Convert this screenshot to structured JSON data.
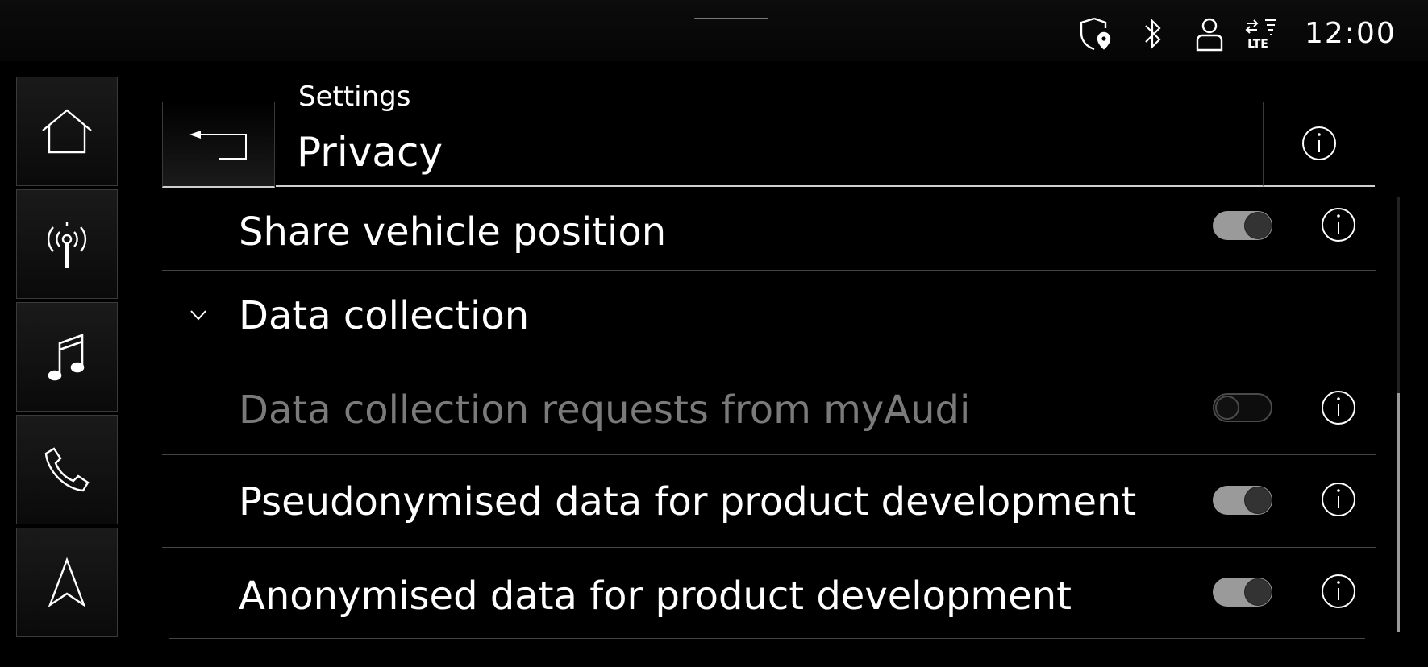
{
  "status_bar": {
    "time": "12:00",
    "network_label": "LTE",
    "icons": [
      "privacy-location-icon",
      "bluetooth-icon",
      "user-profile-icon",
      "lte-signal-icon"
    ]
  },
  "nav": {
    "items": [
      {
        "name": "home",
        "icon": "home-icon"
      },
      {
        "name": "radio",
        "icon": "radio-antenna-icon"
      },
      {
        "name": "media",
        "icon": "music-note-icon"
      },
      {
        "name": "phone",
        "icon": "phone-icon"
      },
      {
        "name": "navigation",
        "icon": "navigation-arrow-icon"
      }
    ]
  },
  "header": {
    "breadcrumb": "Settings",
    "title": "Privacy"
  },
  "rows": [
    {
      "label": "Share vehicle position",
      "toggle": "on",
      "enabled": true
    },
    {
      "label": "Data collection",
      "expandable": true,
      "expanded": true
    },
    {
      "label": "Data collection requests from myAudi",
      "toggle": "off",
      "enabled": false
    },
    {
      "label": "Pseudonymised data for product development",
      "toggle": "on",
      "enabled": true
    },
    {
      "label": "Anonymised data for product development",
      "toggle": "on",
      "enabled": true
    }
  ],
  "colors": {
    "background": "#000000",
    "toggle_on": "#9a9a9a",
    "disabled_text": "#7a7a7a"
  }
}
